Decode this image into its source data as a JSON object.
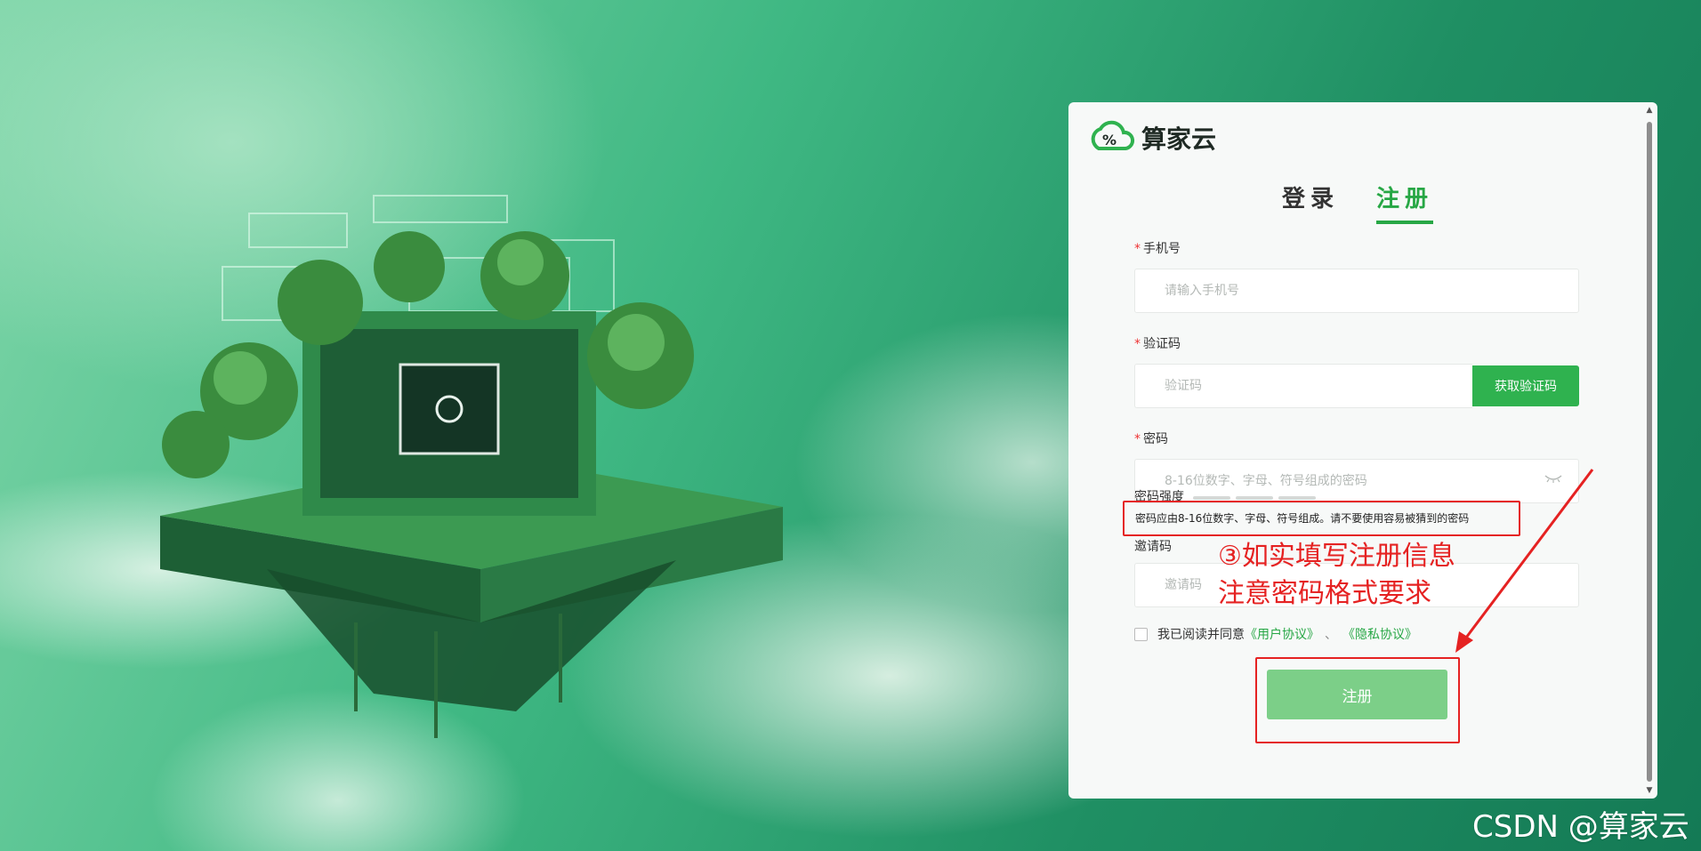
{
  "brand": {
    "name": "算家云",
    "accent": "#27a745"
  },
  "tabs": [
    {
      "label": "登录",
      "active": false
    },
    {
      "label": "注册",
      "active": true
    }
  ],
  "form": {
    "phone": {
      "label": "手机号",
      "placeholder": "请输入手机号",
      "required": true
    },
    "code": {
      "label": "验证码",
      "placeholder": "验证码",
      "button": "获取验证码",
      "required": true
    },
    "password": {
      "label": "密码",
      "placeholder": "8-16位数字、字母、符号组成的密码",
      "required": true,
      "icon": "eye-closed-icon"
    },
    "strength": {
      "label": "密码强度",
      "level": 0
    },
    "hint": "密码应由8-16位数字、字母、符号组成。请不要使用容易被猜到的密码",
    "invite": {
      "label": "邀请码",
      "placeholder": "邀请码"
    },
    "agree": {
      "text": "我已阅读并同意",
      "terms": "《用户协议》",
      "sep": "、",
      "privacy": "《隐私协议》"
    },
    "submit": "注册"
  },
  "annotation": {
    "line1": "③如实填写注册信息",
    "line2": "注意密码格式要求",
    "color": "#e52222"
  },
  "watermark": "CSDN @算家云"
}
